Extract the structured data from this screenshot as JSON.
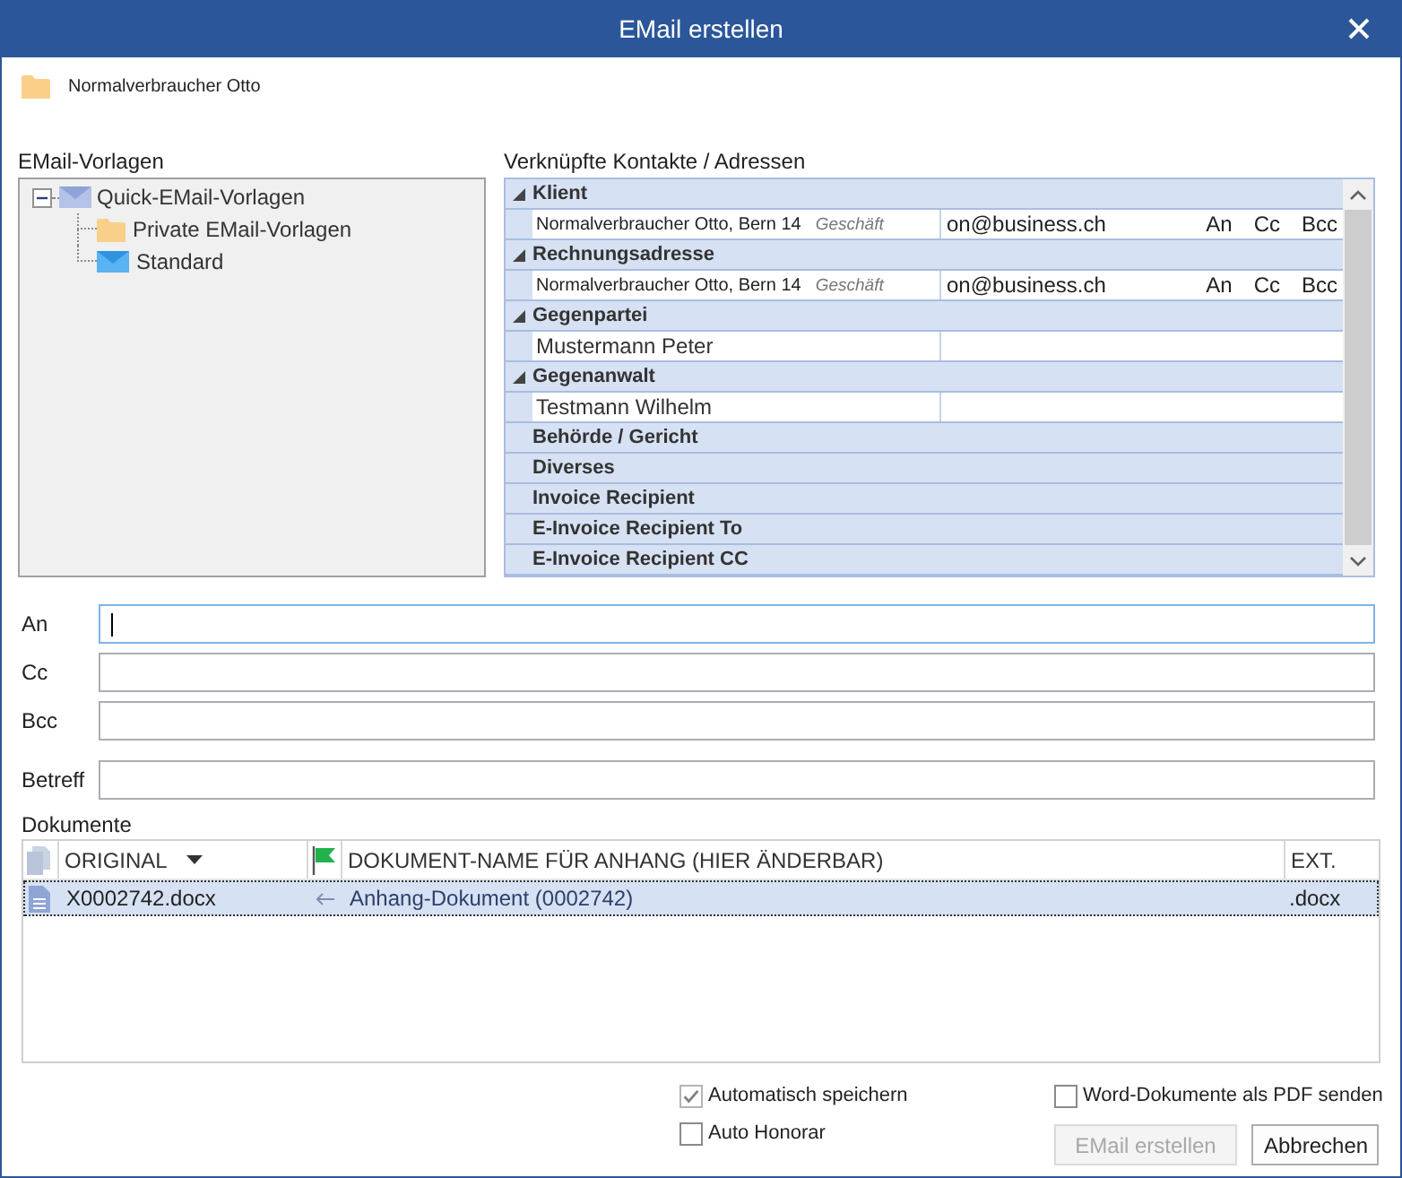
{
  "window": {
    "title": "EMail erstellen"
  },
  "context": {
    "name": "Normalverbraucher Otto"
  },
  "templates": {
    "label": "EMail-Vorlagen",
    "tree": [
      {
        "label": "Quick-EMail-Vorlagen",
        "kind": "group",
        "expanded": true,
        "children": [
          {
            "label": "Private EMail-Vorlagen",
            "kind": "folder"
          },
          {
            "label": "Standard",
            "kind": "template"
          }
        ]
      }
    ]
  },
  "contacts": {
    "label": "Verknüpfte Kontakte / Adressen",
    "groups": [
      {
        "name": "Klient",
        "expanded": true,
        "contacts": [
          {
            "kind": "address",
            "name": "Normalverbraucher Otto, Bern 14",
            "tag": "Geschäft",
            "email": "on@business.ch",
            "actions": [
              "An",
              "Cc",
              "Bcc"
            ]
          }
        ]
      },
      {
        "name": "Rechnungsadresse",
        "expanded": true,
        "contacts": [
          {
            "kind": "address",
            "name": "Normalverbraucher Otto, Bern 14",
            "tag": "Geschäft",
            "email": "on@business.ch",
            "actions": [
              "An",
              "Cc",
              "Bcc"
            ]
          }
        ]
      },
      {
        "name": "Gegenpartei",
        "expanded": true,
        "contacts": [
          {
            "kind": "person",
            "name": "Mustermann Peter"
          }
        ]
      },
      {
        "name": "Gegenanwalt",
        "expanded": true,
        "contacts": [
          {
            "kind": "person",
            "name": "Testmann Wilhelm"
          }
        ]
      },
      {
        "name": "Behörde / Gericht",
        "expanded": false
      },
      {
        "name": "Diverses",
        "expanded": false
      },
      {
        "name": "Invoice Recipient",
        "expanded": false
      },
      {
        "name": "E-Invoice Recipient To",
        "expanded": false
      },
      {
        "name": "E-Invoice Recipient CC",
        "expanded": false
      }
    ]
  },
  "recipients": {
    "fields": [
      {
        "label": "An",
        "focused": true
      },
      {
        "label": "Cc",
        "focused": false
      },
      {
        "label": "Bcc",
        "focused": false
      },
      {
        "label": "Betreff",
        "focused": false
      }
    ]
  },
  "documents": {
    "label": "Dokumente",
    "columns": [
      {
        "kind": "icon"
      },
      {
        "kind": "text",
        "label": "ORIGINAL",
        "dropdown": true
      },
      {
        "kind": "flag"
      },
      {
        "kind": "text",
        "label": "DOKUMENT-NAME FÜR ANHANG (HIER ÄNDERBAR)",
        "dropdown": false
      },
      {
        "kind": "text",
        "label": "EXT.",
        "dropdown": false
      }
    ],
    "rows": [
      {
        "original": "X0002742.docx",
        "name": "Anhang-Dokument (0002742)",
        "ext": ".docx",
        "selected": true
      }
    ]
  },
  "options": [
    {
      "label": "Automatisch speichern",
      "checked": true
    },
    {
      "label": "Auto Honorar",
      "checked": false
    },
    {
      "label": "Word-Dokumente als PDF senden",
      "checked": false
    }
  ],
  "buttons": [
    {
      "label": "EMail erstellen",
      "disabled": true
    },
    {
      "label": "Abbrechen",
      "disabled": false
    }
  ]
}
